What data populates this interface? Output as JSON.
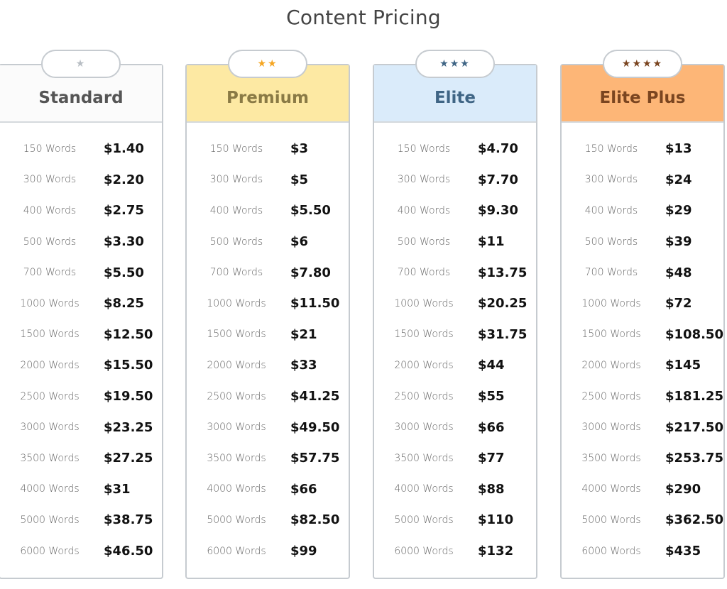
{
  "title": "Content Pricing",
  "plans": [
    {
      "name": "Standard",
      "stars": "★",
      "star_count": 1,
      "header_bg": "#fbfbfb",
      "name_color": "#555555",
      "star_color": "#b8bec4",
      "rows": [
        {
          "words": "150 Words",
          "price": "$1.40"
        },
        {
          "words": "300 Words",
          "price": "$2.20"
        },
        {
          "words": "400 Words",
          "price": "$2.75"
        },
        {
          "words": "500 Words",
          "price": "$3.30"
        },
        {
          "words": "700 Words",
          "price": "$5.50"
        },
        {
          "words": "1000 Words",
          "price": "$8.25"
        },
        {
          "words": "1500 Words",
          "price": "$12.50"
        },
        {
          "words": "2000 Words",
          "price": "$15.50"
        },
        {
          "words": "2500 Words",
          "price": "$19.50"
        },
        {
          "words": "3000 Words",
          "price": "$23.25"
        },
        {
          "words": "3500 Words",
          "price": "$27.25"
        },
        {
          "words": "4000 Words",
          "price": "$31"
        },
        {
          "words": "5000 Words",
          "price": "$38.75"
        },
        {
          "words": "6000 Words",
          "price": "$46.50"
        }
      ]
    },
    {
      "name": "Premium",
      "stars": "★★",
      "star_count": 2,
      "header_bg": "#fde9a3",
      "name_color": "#8a7a45",
      "star_color": "#f5a623",
      "rows": [
        {
          "words": "150 Words",
          "price": "$3"
        },
        {
          "words": "300 Words",
          "price": "$5"
        },
        {
          "words": "400 Words",
          "price": "$5.50"
        },
        {
          "words": "500 Words",
          "price": "$6"
        },
        {
          "words": "700 Words",
          "price": "$7.80"
        },
        {
          "words": "1000 Words",
          "price": "$11.50"
        },
        {
          "words": "1500 Words",
          "price": "$21"
        },
        {
          "words": "2000 Words",
          "price": "$33"
        },
        {
          "words": "2500 Words",
          "price": "$41.25"
        },
        {
          "words": "3000 Words",
          "price": "$49.50"
        },
        {
          "words": "3500 Words",
          "price": "$57.75"
        },
        {
          "words": "4000 Words",
          "price": "$66"
        },
        {
          "words": "5000 Words",
          "price": "$82.50"
        },
        {
          "words": "6000 Words",
          "price": "$99"
        }
      ]
    },
    {
      "name": "Elite",
      "stars": "★★★",
      "star_count": 3,
      "header_bg": "#daebfa",
      "name_color": "#3f6585",
      "star_color": "#3f6585",
      "rows": [
        {
          "words": "150 Words",
          "price": "$4.70"
        },
        {
          "words": "300 Words",
          "price": "$7.70"
        },
        {
          "words": "400 Words",
          "price": "$9.30"
        },
        {
          "words": "500 Words",
          "price": "$11"
        },
        {
          "words": "700 Words",
          "price": "$13.75"
        },
        {
          "words": "1000 Words",
          "price": "$20.25"
        },
        {
          "words": "1500 Words",
          "price": "$31.75"
        },
        {
          "words": "2000 Words",
          "price": "$44"
        },
        {
          "words": "2500 Words",
          "price": "$55"
        },
        {
          "words": "3000 Words",
          "price": "$66"
        },
        {
          "words": "3500 Words",
          "price": "$77"
        },
        {
          "words": "4000 Words",
          "price": "$88"
        },
        {
          "words": "5000 Words",
          "price": "$110"
        },
        {
          "words": "6000 Words",
          "price": "$132"
        }
      ]
    },
    {
      "name": "Elite Plus",
      "stars": "★★★★",
      "star_count": 4,
      "header_bg": "#fdb677",
      "name_color": "#7a4520",
      "star_color": "#7a4520",
      "rows": [
        {
          "words": "150 Words",
          "price": "$13"
        },
        {
          "words": "300 Words",
          "price": "$24"
        },
        {
          "words": "400 Words",
          "price": "$29"
        },
        {
          "words": "500 Words",
          "price": "$39"
        },
        {
          "words": "700 Words",
          "price": "$48"
        },
        {
          "words": "1000 Words",
          "price": "$72"
        },
        {
          "words": "1500 Words",
          "price": "$108.50"
        },
        {
          "words": "2000 Words",
          "price": "$145"
        },
        {
          "words": "2500 Words",
          "price": "$181.25"
        },
        {
          "words": "3000 Words",
          "price": "$217.50"
        },
        {
          "words": "3500 Words",
          "price": "$253.75"
        },
        {
          "words": "4000 Words",
          "price": "$290"
        },
        {
          "words": "5000 Words",
          "price": "$362.50"
        },
        {
          "words": "6000 Words",
          "price": "$435"
        }
      ]
    }
  ]
}
